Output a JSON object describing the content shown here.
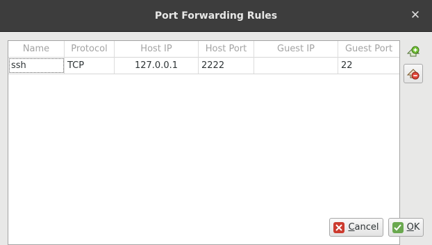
{
  "dialog": {
    "title": "Port Forwarding Rules",
    "close_glyph": "✕"
  },
  "table": {
    "columns": [
      "Name",
      "Protocol",
      "Host IP",
      "Host Port",
      "Guest IP",
      "Guest Port"
    ],
    "rows": [
      [
        "ssh",
        "TCP",
        "127.0.0.1",
        "2222",
        "",
        "22"
      ]
    ]
  },
  "side_buttons": {
    "add_icon": "add-rule-icon",
    "remove_icon": "remove-rule-icon"
  },
  "footer": {
    "cancel_label": "Cancel",
    "ok_label": "OK"
  },
  "colors": {
    "titlebar": "#3d3d3d",
    "cancel_icon": "#cc3b2f",
    "ok_icon": "#6aa84f",
    "add_icon": "#4e9a06",
    "remove_icon": "#cc3b2f"
  }
}
